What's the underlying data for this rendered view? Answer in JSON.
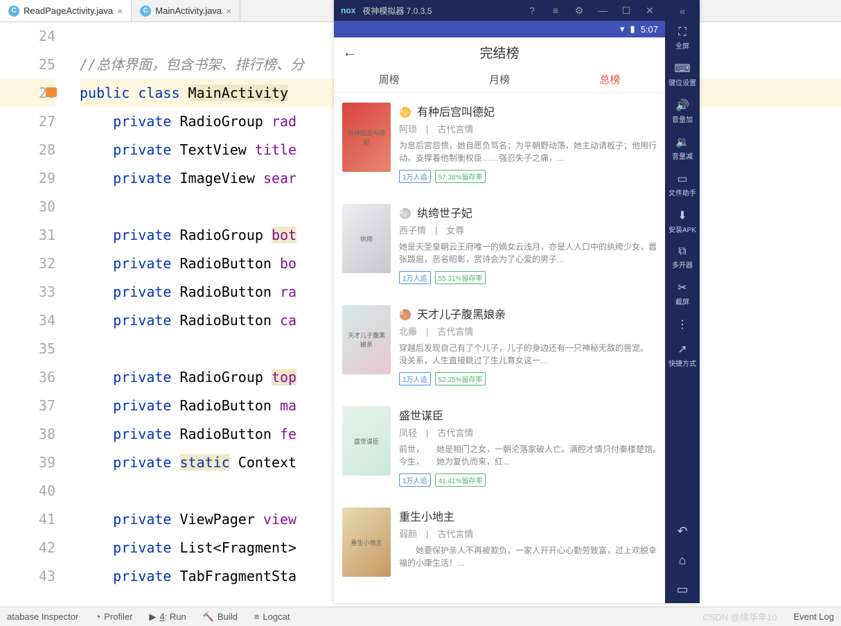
{
  "ide": {
    "tabs": [
      {
        "name": "ReadPageActivity.java",
        "active": true
      },
      {
        "name": "MainActivity.java",
        "active": false
      }
    ],
    "lines": [
      {
        "n": "24",
        "html": ""
      },
      {
        "n": "25",
        "html": "<span class='cmt'>//总体界面，包含书架、排行榜、分</span>"
      },
      {
        "n": "26",
        "html": "<span class='kw'>public class</span> <span class='hl-yel'>MainActivity</span> ",
        "hl": true,
        "icon": true
      },
      {
        "n": "27",
        "html": "    <span class='kw'>private</span> RadioGroup <span class='ident'>rad</span>"
      },
      {
        "n": "28",
        "html": "    <span class='kw'>private</span> TextView <span class='ident'>title</span>"
      },
      {
        "n": "29",
        "html": "    <span class='kw'>private</span> ImageView <span class='ident'>sear</span>"
      },
      {
        "n": "30",
        "html": ""
      },
      {
        "n": "31",
        "html": "    <span class='kw'>private</span> RadioGroup <span class='ident'><span class='hl-yel'>bot</span></span>"
      },
      {
        "n": "32",
        "html": "    <span class='kw'>private</span> RadioButton <span class='ident'>bo</span>"
      },
      {
        "n": "33",
        "html": "    <span class='kw'>private</span> RadioButton <span class='ident'>ra</span>"
      },
      {
        "n": "34",
        "html": "    <span class='kw'>private</span> RadioButton <span class='ident'>ca</span>"
      },
      {
        "n": "35",
        "html": ""
      },
      {
        "n": "36",
        "html": "    <span class='kw'>private</span> RadioGroup <span class='ident'><span class='hl-yel'>top</span></span>"
      },
      {
        "n": "37",
        "html": "    <span class='kw'>private</span> RadioButton <span class='ident'>ma</span>"
      },
      {
        "n": "38",
        "html": "    <span class='kw'>private</span> RadioButton <span class='ident'>fe</span>"
      },
      {
        "n": "39",
        "html": "    <span class='kw'>private</span> <span class='hl-yel'><span class='kw'>static</span></span> Context"
      },
      {
        "n": "40",
        "html": ""
      },
      {
        "n": "41",
        "html": "    <span class='kw'>private</span> ViewPager <span class='ident'>view</span>"
      },
      {
        "n": "42",
        "html": "    <span class='kw'>private</span> List&lt;Fragment&gt;"
      },
      {
        "n": "43",
        "html": "    <span class='kw'>private</span> TabFragmentSta"
      }
    ],
    "bottom": {
      "db": "atabase Inspector",
      "profiler": "Profiler",
      "run": "4: Run",
      "run_underline": "4",
      "build": "Build",
      "logcat": "Logcat",
      "eventlog": "Event Log",
      "watermark": "CSDN @缘华年10"
    }
  },
  "emu": {
    "title": "夜神模拟器 7.0.3.5",
    "brand": "nox",
    "status_time": "5:07",
    "app_title": "完结榜",
    "tabs": [
      "周榜",
      "月榜",
      "总榜"
    ],
    "tab_active": 2,
    "side_items": [
      {
        "icon": "⛶",
        "label": "全屏"
      },
      {
        "icon": "⌨",
        "label": "键位设置"
      },
      {
        "icon": "🔊",
        "label": "音量加"
      },
      {
        "icon": "🔉",
        "label": "音量减"
      },
      {
        "icon": "▭",
        "label": "文件助手"
      },
      {
        "icon": "⬇",
        "label": "安装APK"
      },
      {
        "icon": "⧉",
        "label": "多开器"
      },
      {
        "icon": "✂",
        "label": "截屏"
      }
    ],
    "side_more": "⋮",
    "side_shortcut": {
      "icon": "↗",
      "label": "快捷方式"
    },
    "books": [
      {
        "medal": "1",
        "medalClass": "medal-g",
        "title": "有种后宫叫德妃",
        "author": "阿琐",
        "category": "古代言情",
        "desc": "为息后宫怨愤，她自愿负骂名；为平朝野动荡，她主动请板子；他用行动，支撑着他制衡权臣……强忍失子之痛，...",
        "follow": "1万人追",
        "retain": "57.38%留存率",
        "coverClass": "bc1",
        "coverText": "有种后宫叫德妃"
      },
      {
        "medal": "2",
        "medalClass": "medal-s",
        "title": "纨绔世子妃",
        "author": "西子情",
        "category": "女尊",
        "desc": "她是天圣皇朝云王府唯一的嫡女云浅月，亦是人人口中的纨绔少女，嚣张跋扈，恶名昭彰，赏诗会为了心爱的男子...",
        "follow": "1万人追",
        "retain": "55.31%留存率",
        "coverClass": "bc2",
        "coverText": "纨绔"
      },
      {
        "medal": "3",
        "medalClass": "medal-b",
        "title": "天才儿子腹黑娘亲",
        "author": "北藤",
        "category": "古代言情",
        "desc": "穿越后发现自己有了个儿子，儿子的身边还有一只神秘无敌的兽宠。　　没关系，人生直接跳过了生儿育女这一...",
        "follow": "1万人追",
        "retain": "52.25%留存率",
        "coverClass": "bc3",
        "coverText": "天才儿子腹黑娘亲"
      },
      {
        "medal": "",
        "medalClass": "",
        "title": "盛世谋臣",
        "author": "凤轻",
        "category": "古代言情",
        "desc": "前世，　　她是相门之女，一朝沦落家破人亡。满腔才情只付秦楼楚馆。　　今生，　　她为复仇而来，红...",
        "follow": "1万人追",
        "retain": "41.41%留存率",
        "coverClass": "bc4",
        "coverText": "盛世谋臣"
      },
      {
        "medal": "",
        "medalClass": "",
        "title": "重生小地主",
        "author": "弱颜",
        "category": "古代言情",
        "desc": "　　她要保护亲人不再被欺负，一家人开开心心勤劳致富，过上欢脱幸福的小康生活！...",
        "follow": "",
        "retain": "",
        "coverClass": "bc5",
        "coverText": "重生小地主"
      }
    ]
  }
}
